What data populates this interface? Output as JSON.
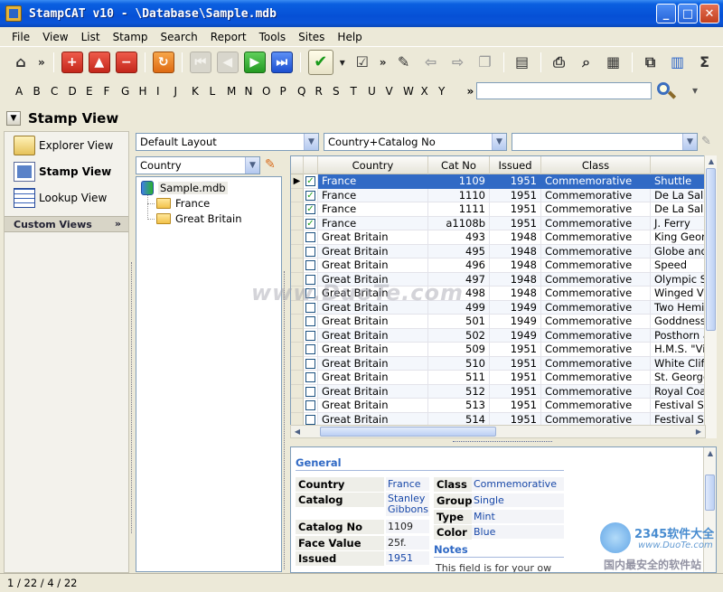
{
  "window": {
    "title": "StampCAT v10 - \\Database\\Sample.mdb"
  },
  "menu": [
    "File",
    "View",
    "List",
    "Stamp",
    "Search",
    "Report",
    "Tools",
    "Sites",
    "Help"
  ],
  "alphabet": [
    "A",
    "B",
    "C",
    "D",
    "E",
    "F",
    "G",
    "H",
    "I",
    "J",
    "K",
    "L",
    "M",
    "N",
    "O",
    "P",
    "Q",
    "R",
    "S",
    "T",
    "U",
    "V",
    "W",
    "X",
    "Y"
  ],
  "toolbar": {
    "overflow_glyph": "»"
  },
  "view": {
    "title": "Stamp View",
    "nav": {
      "explorer": "Explorer View",
      "stamp": "Stamp View",
      "lookup": "Lookup View",
      "custom_views": "Custom Views"
    }
  },
  "combos": {
    "layout": "Default Layout",
    "sort": "Country+Catalog No",
    "third": "",
    "tree_field": "Country"
  },
  "tree": {
    "root": "Sample.mdb",
    "children": [
      "France",
      "Great Britain"
    ]
  },
  "grid": {
    "columns": [
      "Country",
      "Cat No",
      "Issued",
      "Class",
      ""
    ],
    "rows": [
      {
        "checked": true,
        "country": "France",
        "cat": "1109",
        "issued": "1951",
        "class": "Commemorative",
        "name": "Shuttle"
      },
      {
        "checked": true,
        "country": "France",
        "cat": "1110",
        "issued": "1951",
        "class": "Commemorative",
        "name": "De La Salle"
      },
      {
        "checked": true,
        "country": "France",
        "cat": "1111",
        "issued": "1951",
        "class": "Commemorative",
        "name": "De La Salle"
      },
      {
        "checked": true,
        "country": "France",
        "cat": "a1108b",
        "issued": "1951",
        "class": "Commemorative",
        "name": "J. Ferry"
      },
      {
        "checked": false,
        "country": "Great Britain",
        "cat": "493",
        "issued": "1948",
        "class": "Commemorative",
        "name": "King George"
      },
      {
        "checked": false,
        "country": "Great Britain",
        "cat": "495",
        "issued": "1948",
        "class": "Commemorative",
        "name": "Globe and L"
      },
      {
        "checked": false,
        "country": "Great Britain",
        "cat": "496",
        "issued": "1948",
        "class": "Commemorative",
        "name": "Speed"
      },
      {
        "checked": false,
        "country": "Great Britain",
        "cat": "497",
        "issued": "1948",
        "class": "Commemorative",
        "name": "Olympic Sym"
      },
      {
        "checked": false,
        "country": "Great Britain",
        "cat": "498",
        "issued": "1948",
        "class": "Commemorative",
        "name": "Winged Vict"
      },
      {
        "checked": false,
        "country": "Great Britain",
        "cat": "499",
        "issued": "1949",
        "class": "Commemorative",
        "name": "Two Hemisp"
      },
      {
        "checked": false,
        "country": "Great Britain",
        "cat": "501",
        "issued": "1949",
        "class": "Commemorative",
        "name": "Goddness C"
      },
      {
        "checked": false,
        "country": "Great Britain",
        "cat": "502",
        "issued": "1949",
        "class": "Commemorative",
        "name": "Posthorn ar"
      },
      {
        "checked": false,
        "country": "Great Britain",
        "cat": "509",
        "issued": "1951",
        "class": "Commemorative",
        "name": "H.M.S. \"Vict"
      },
      {
        "checked": false,
        "country": "Great Britain",
        "cat": "510",
        "issued": "1951",
        "class": "Commemorative",
        "name": "White Cliffs"
      },
      {
        "checked": false,
        "country": "Great Britain",
        "cat": "511",
        "issued": "1951",
        "class": "Commemorative",
        "name": "St. George a"
      },
      {
        "checked": false,
        "country": "Great Britain",
        "cat": "512",
        "issued": "1951",
        "class": "Commemorative",
        "name": "Royal Coat"
      },
      {
        "checked": false,
        "country": "Great Britain",
        "cat": "513",
        "issued": "1951",
        "class": "Commemorative",
        "name": "Festival Syn"
      },
      {
        "checked": false,
        "country": "Great Britain",
        "cat": "514",
        "issued": "1951",
        "class": "Commemorative",
        "name": "Festival Syn"
      }
    ]
  },
  "detail": {
    "general_title": "General",
    "notes_title": "Notes",
    "notes_text": "This field is for your ow",
    "fields_left": [
      {
        "label": "Country",
        "value": "France"
      },
      {
        "label": "Catalog",
        "value": "Stanley Gibbons"
      },
      {
        "label": "Catalog No",
        "value": "1109"
      },
      {
        "label": "Face Value",
        "value": "25f."
      },
      {
        "label": "Issued",
        "value": "1951"
      }
    ],
    "fields_right": [
      {
        "label": "Class",
        "value": "Commemorative"
      },
      {
        "label": "Group",
        "value": "Single"
      },
      {
        "label": "Type",
        "value": "Mint"
      },
      {
        "label": "Color",
        "value": "Blue"
      }
    ]
  },
  "status": {
    "position": "1 / 22 / 4 / 22"
  },
  "watermarks": {
    "center": "www.DuoTe.com",
    "brand": "2345软件大全",
    "url": "www.DuoTe.com",
    "tagline": "国内最安全的软件站"
  },
  "colors": {
    "selection": "#316ac5",
    "title_bar": "#0650d6",
    "accent_text": "#1848a8"
  }
}
